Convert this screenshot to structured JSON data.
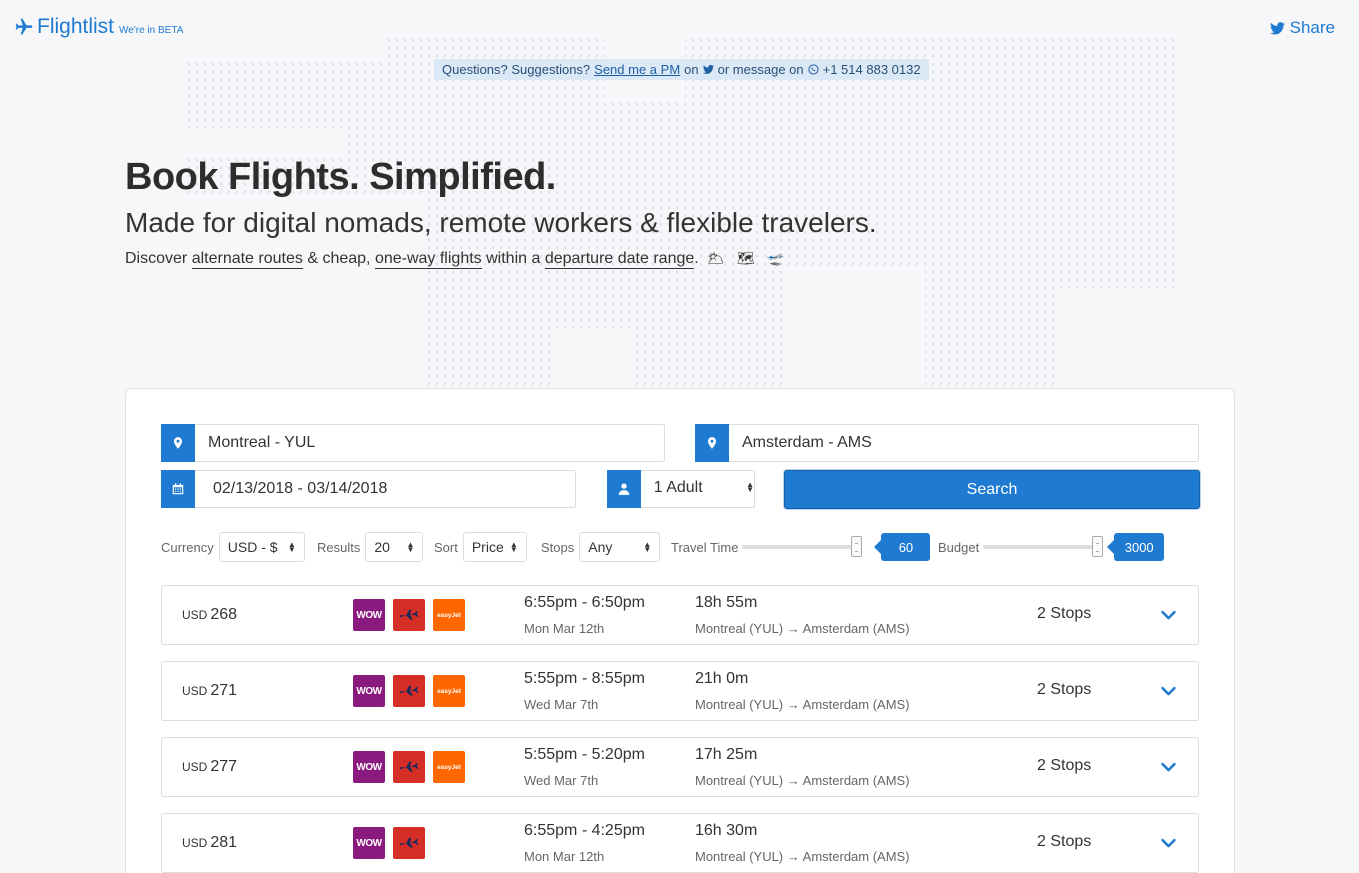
{
  "brand": {
    "name": "Flightlist",
    "beta": "We're in BETA"
  },
  "share": {
    "label": "Share"
  },
  "notice": {
    "prefix": "Questions? Suggestions?",
    "link": "Send me a PM",
    "on": "on",
    "middle": "or message on",
    "phone": "+1 514 883 0132"
  },
  "hero": {
    "title": "Book Flights. Simplified.",
    "subtitle": "Made for digital nomads, remote workers & flexible travelers.",
    "desc_1": "Discover",
    "link_1": "alternate routes",
    "desc_2": "& cheap,",
    "link_2": "one-way flights",
    "desc_3": "within a",
    "link_3": "departure date range",
    "desc_4": ".",
    "emoji": "🌥 🗺 🛫"
  },
  "search": {
    "origin": "Montreal - YUL",
    "destination": "Amsterdam - AMS",
    "dates": "02/13/2018 - 03/14/2018",
    "passengers": "1 Adult",
    "button": "Search"
  },
  "filters": {
    "currency_label": "Currency",
    "currency_value": "USD - $",
    "results_label": "Results",
    "results_value": "20",
    "sort_label": "Sort",
    "sort_value": "Price",
    "stops_label": "Stops",
    "stops_value": "Any",
    "travel_label": "Travel Time",
    "travel_value": "60",
    "travel_fraction": 1.0,
    "budget_label": "Budget",
    "budget_value": "3000",
    "budget_fraction": 1.0
  },
  "results": [
    {
      "currency": "USD",
      "price": "268",
      "airlines": [
        "WOW",
        "red",
        "easyJet"
      ],
      "times": "6:55pm - 6:50pm",
      "date": "Mon Mar 12th",
      "duration": "18h 55m",
      "route": "Montreal (YUL) → Amsterdam (AMS)",
      "stops": "2 Stops"
    },
    {
      "currency": "USD",
      "price": "271",
      "airlines": [
        "WOW",
        "red",
        "easyJet"
      ],
      "times": "5:55pm - 8:55pm",
      "date": "Wed Mar 7th",
      "duration": "21h 0m",
      "route": "Montreal (YUL) → Amsterdam (AMS)",
      "stops": "2 Stops"
    },
    {
      "currency": "USD",
      "price": "277",
      "airlines": [
        "WOW",
        "red",
        "easyJet"
      ],
      "times": "5:55pm - 5:20pm",
      "date": "Wed Mar 7th",
      "duration": "17h 25m",
      "route": "Montreal (YUL) → Amsterdam (AMS)",
      "stops": "2 Stops"
    },
    {
      "currency": "USD",
      "price": "281",
      "airlines": [
        "WOW",
        "red"
      ],
      "times": "6:55pm - 4:25pm",
      "date": "Mon Mar 12th",
      "duration": "16h 30m",
      "route": "Montreal (YUL) → Amsterdam (AMS)",
      "stops": "2 Stops"
    }
  ],
  "logo_text": {
    "wow": "WOW",
    "easy": "easyJet"
  },
  "colors": {
    "accent": "#1f7ad1",
    "wow": "#8a1a7e",
    "red_airline": "#d42e27",
    "easyjet": "#ff6600"
  }
}
